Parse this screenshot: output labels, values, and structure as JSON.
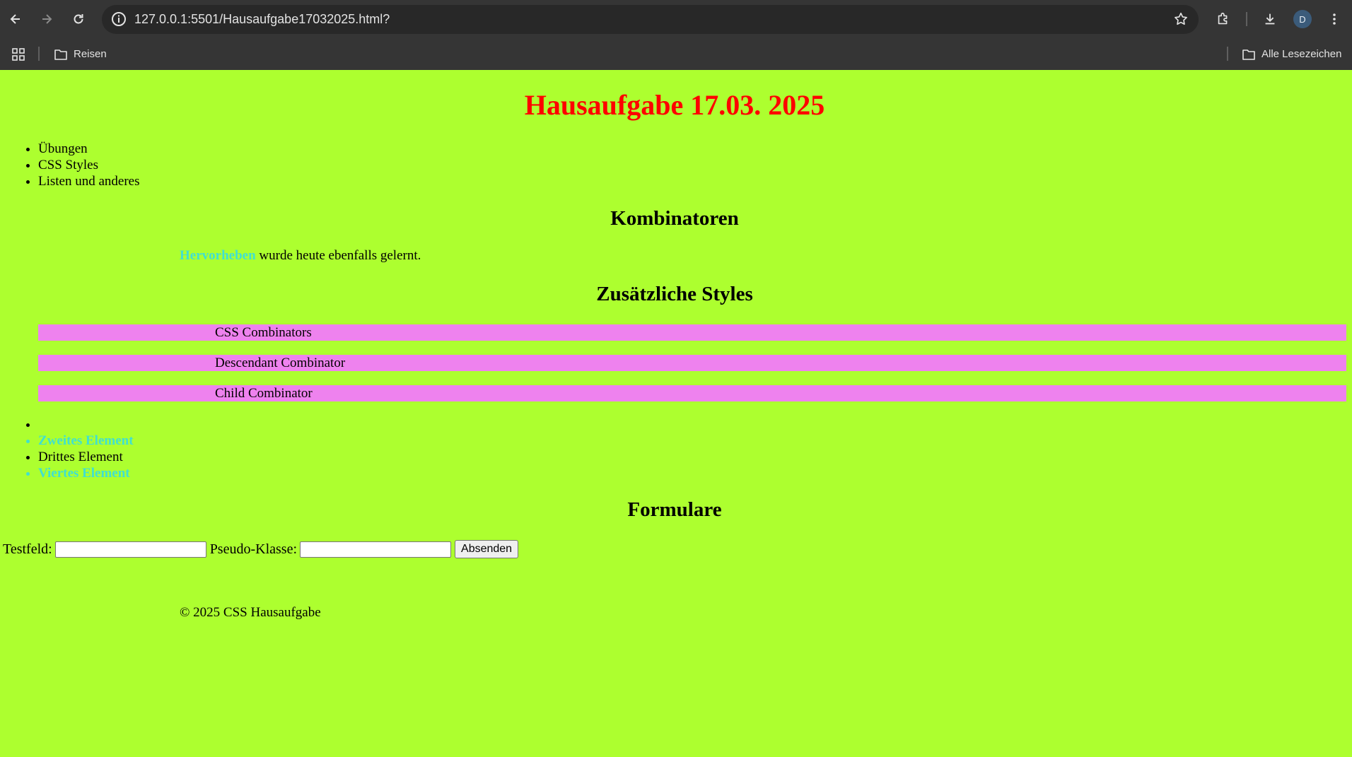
{
  "browser": {
    "url": "127.0.0.1:5501/Hausaufgabe17032025.html?",
    "avatar_letter": "D",
    "bookmarks": {
      "folder": "Reisen",
      "all_bookmarks": "Alle Lesezeichen"
    }
  },
  "page": {
    "title": "Hausaufgabe 17.03. 2025",
    "nav": [
      "Übungen",
      "CSS Styles",
      "Listen und anderes"
    ],
    "combinators": {
      "heading": "Kombinatoren",
      "highlight": "Hervorheben",
      "text": " wurde heute ebenfalls gelernt."
    },
    "styles": {
      "heading": "Zusätzliche Styles",
      "bars": [
        "CSS Combinators",
        "Descendant Combinator",
        "Child Combinator"
      ]
    },
    "elements": [
      "",
      "Zweites Element",
      "Drittes Element",
      "Viertes Element"
    ],
    "form": {
      "heading": "Formulare",
      "label1": "Testfeld:",
      "value1": "",
      "label2": "Pseudo-Klasse:",
      "value2": "",
      "submit": "Absenden"
    },
    "footer": "© 2025 CSS Hausaufgabe"
  },
  "colors": {
    "background": "#adff2f",
    "title": "#ff0000",
    "highlight": "#40e0d0",
    "bar": "#ee82ee"
  }
}
